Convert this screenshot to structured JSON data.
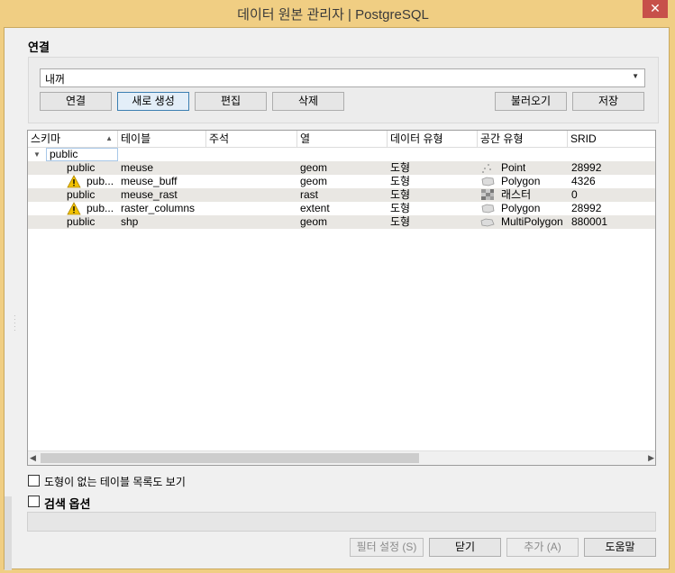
{
  "window": {
    "title": "데이터 원본 관리자 | PostgreSQL",
    "close_glyph": "✕"
  },
  "connection": {
    "section_label": "연결",
    "selected": "내꺼",
    "buttons": {
      "connect": "연결",
      "new": "새로 생성",
      "edit": "편집",
      "delete": "삭제",
      "load": "불러오기",
      "save": "저장"
    }
  },
  "table": {
    "columns": [
      "스키마",
      "테이블",
      "주석",
      "열",
      "데이터 유형",
      "공간 유형",
      "SRID"
    ],
    "group": "public",
    "rows": [
      {
        "schema": "public",
        "table": "meuse",
        "comment": "",
        "column": "geom",
        "data_type": "도형",
        "spatial_type": "Point",
        "srid": "28992",
        "warning": false,
        "icon": "point-icon"
      },
      {
        "schema": "pub...",
        "table": "meuse_buff",
        "comment": "",
        "column": "geom",
        "data_type": "도형",
        "spatial_type": "Polygon",
        "srid": "4326",
        "warning": true,
        "icon": "polygon-icon"
      },
      {
        "schema": "public",
        "table": "meuse_rast",
        "comment": "",
        "column": "rast",
        "data_type": "도형",
        "spatial_type": "래스터",
        "srid": "0",
        "warning": false,
        "icon": "raster-icon"
      },
      {
        "schema": "pub...",
        "table": "raster_columns",
        "comment": "",
        "column": "extent",
        "data_type": "도형",
        "spatial_type": "Polygon",
        "srid": "28992",
        "warning": true,
        "icon": "polygon-icon"
      },
      {
        "schema": "public",
        "table": "shp",
        "comment": "",
        "column": "geom",
        "data_type": "도형",
        "spatial_type": "MultiPolygon",
        "srid": "880001",
        "warning": false,
        "icon": "multipolygon-icon"
      }
    ]
  },
  "options": {
    "no_geom_label": "도형이 없는 테이블 목록도 보기",
    "search_options_label": "검색 옵션"
  },
  "footer": {
    "filter": "필터 설정 (S)",
    "close": "닫기",
    "add": "추가 (A)",
    "help": "도움말"
  }
}
